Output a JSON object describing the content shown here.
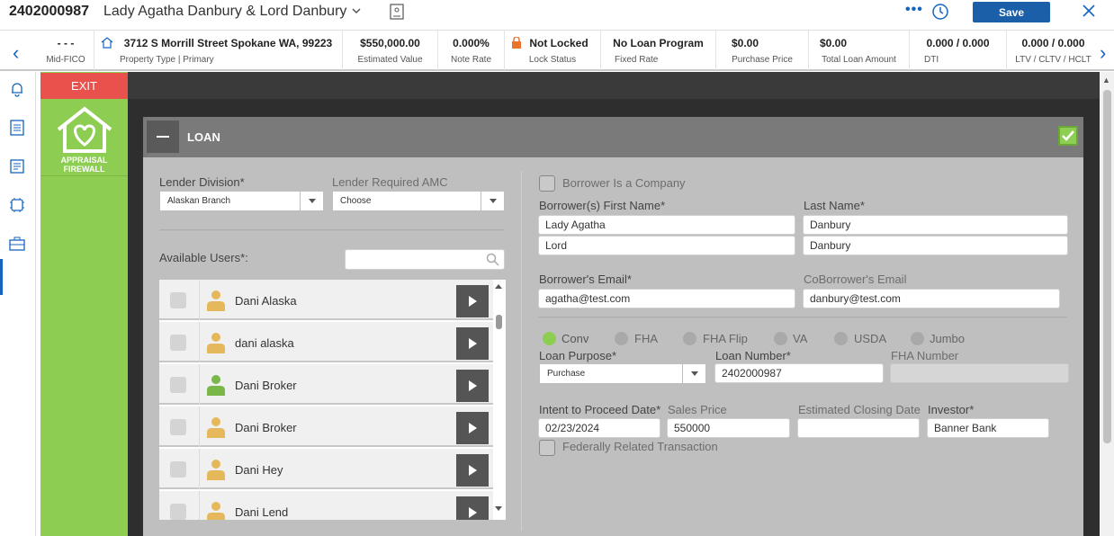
{
  "header": {
    "loan_id": "2402000987",
    "borrower_title": "Lady Agatha Danbury & Lord Danbury",
    "more_label": "•••",
    "save_label": "Save"
  },
  "info_strip": [
    {
      "value": "- - -",
      "label": "Mid-FICO"
    },
    {
      "value": "3712 S Morrill Street Spokane WA, 99223",
      "label": "Property Type | Primary"
    },
    {
      "value": "$550,000.00",
      "label": "Estimated Value"
    },
    {
      "value": "0.000%",
      "label": "Note Rate"
    },
    {
      "value": "Not Locked",
      "label": "Lock Status"
    },
    {
      "value": "No Loan Program",
      "label": "Fixed Rate"
    },
    {
      "value": "$0.00",
      "label": "Purchase Price"
    },
    {
      "value": "$0.00",
      "label": "Total Loan Amount"
    },
    {
      "value": "0.000 / 0.000",
      "label": "DTI"
    },
    {
      "value": "0.000 / 0.000",
      "label": "LTV / CLTV / HCLT"
    }
  ],
  "app": {
    "exit_label": "EXIT",
    "logo_line1": "APPRAISAL",
    "logo_line2": "FIREWALL"
  },
  "panel": {
    "title": "LOAN",
    "lender_division_label": "Lender Division*",
    "lender_division_value": "Alaskan Branch",
    "lender_amc_label": "Lender Required AMC",
    "lender_amc_value": "Choose",
    "available_users_label": "Available Users*:",
    "users": [
      {
        "name": "Dani Alaska",
        "avatar": "user-yellow"
      },
      {
        "name": "dani alaska",
        "avatar": "user-yellow"
      },
      {
        "name": "Dani Broker",
        "avatar": "user-green"
      },
      {
        "name": "Dani Broker",
        "avatar": "user-yellow"
      },
      {
        "name": "Dani Hey",
        "avatar": "user-yellow"
      },
      {
        "name": "Dani Lend",
        "avatar": "user-yellow"
      }
    ],
    "borrower_company_label": "Borrower Is a Company",
    "first_name_label": "Borrower(s) First Name*",
    "last_name_label": "Last Name*",
    "first_name_1": "Lady Agatha",
    "last_name_1": "Danbury",
    "first_name_2": "Lord",
    "last_name_2": "Danbury",
    "borrower_email_label": "Borrower's Email*",
    "borrower_email": "agatha@test.com",
    "coborrower_email_label": "CoBorrower's Email",
    "coborrower_email": "danbury@test.com",
    "loan_types": [
      {
        "label": "Conv",
        "selected": true
      },
      {
        "label": "FHA",
        "selected": false
      },
      {
        "label": "FHA Flip",
        "selected": false
      },
      {
        "label": "VA",
        "selected": false
      },
      {
        "label": "USDA",
        "selected": false
      },
      {
        "label": "Jumbo",
        "selected": false
      }
    ],
    "loan_purpose_label": "Loan Purpose*",
    "loan_purpose_value": "Purchase",
    "loan_number_label": "Loan Number*",
    "loan_number_value": "2402000987",
    "fha_number_label": "FHA Number",
    "intent_label": "Intent to Proceed Date*",
    "intent_value": "02/23/2024",
    "sales_price_label": "Sales Price",
    "sales_price_value": "550000",
    "closing_date_label": "Estimated Closing Date",
    "investor_label": "Investor*",
    "investor_value": "Banner Bank",
    "federal_label": "Federally Related Transaction"
  },
  "colors": {
    "accent": "#1a5fa8",
    "green": "#8ccd52",
    "exit": "#e8514c"
  }
}
